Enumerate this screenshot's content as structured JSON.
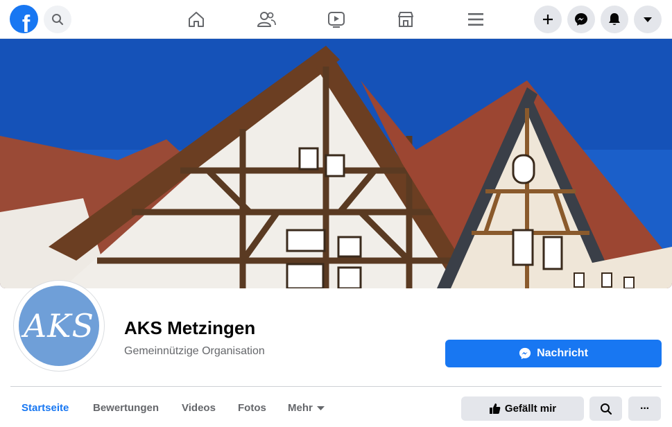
{
  "topbar": {
    "logo_letter": "f",
    "nav_icons": [
      "home-icon",
      "friends-icon",
      "watch-icon",
      "marketplace-icon",
      "menu-icon"
    ],
    "actions": [
      "plus-icon",
      "messenger-icon",
      "notifications-icon",
      "chevron-down-icon"
    ]
  },
  "profile": {
    "avatar_text": "AKS",
    "name": "AKS Metzingen",
    "category": "Gemeinnützige Organisation",
    "message_button": "Nachricht"
  },
  "tabs": [
    {
      "label": "Startseite",
      "active": true
    },
    {
      "label": "Bewertungen",
      "active": false
    },
    {
      "label": "Videos",
      "active": false
    },
    {
      "label": "Fotos",
      "active": false
    },
    {
      "label": "Mehr",
      "active": false
    }
  ],
  "page_actions": {
    "like_label": "Gefällt mir",
    "more_label": "···"
  },
  "colors": {
    "brand": "#1877f2",
    "sky": "#1a5fc8",
    "roof": "#9a4a36",
    "beam": "#5a3a22"
  }
}
